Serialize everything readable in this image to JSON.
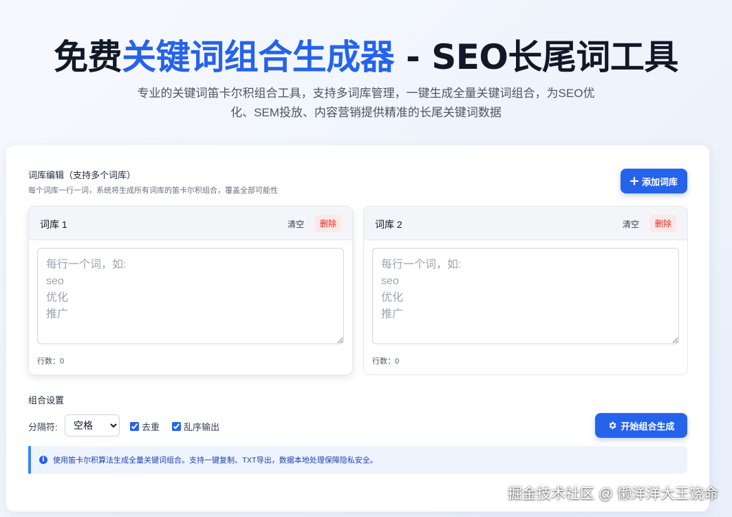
{
  "hero": {
    "title_pre": "免费",
    "title_accent": "关键词组合生成器",
    "title_post": " - SEO长尾词工具",
    "subtitle": "专业的关键词笛卡尔积组合工具，支持多词库管理，一键生成全量关键词组合，为SEO优化、SEM投放、内容营销提供精准的长尾关键词数据"
  },
  "editor": {
    "title": "词库编辑（支持多个词库）",
    "desc": "每个词库一行一词，系统将生成所有词库的笛卡尔积组合，覆盖全部可能性",
    "add_label": "添加词库",
    "add_icon": "plus-icon"
  },
  "libraries": [
    {
      "name": "词库 1",
      "clear": "清空",
      "delete": "删除",
      "value": "",
      "placeholder": "每行一个词，如:\nseo\n优化\n推广",
      "count": "行数：0"
    },
    {
      "name": "词库 2",
      "clear": "清空",
      "delete": "删除",
      "value": "",
      "placeholder": "每行一个词，如:\nseo\n优化\n推广",
      "count": "行数：0"
    }
  ],
  "settings": {
    "title": "组合设置",
    "separator_label": "分隔符:",
    "separator_value": "空格",
    "dedupe_label": "去重",
    "dedupe_checked": true,
    "shuffle_label": "乱序输出",
    "shuffle_checked": true,
    "start_label": "开始组合生成",
    "start_icon": "gear-icon"
  },
  "info": {
    "icon": "info-icon",
    "text": "使用笛卡尔积算法生成全量关键词组合。支持一键复制、TXT导出，数据本地处理保障隐私安全。"
  },
  "watermark": "掘金技术社区 @ 懒洋洋大王饶命",
  "colors": {
    "primary": "#2563eb",
    "danger": "#dc2626",
    "danger_bg": "#fde8e8",
    "info_bg": "#eef4fd"
  }
}
